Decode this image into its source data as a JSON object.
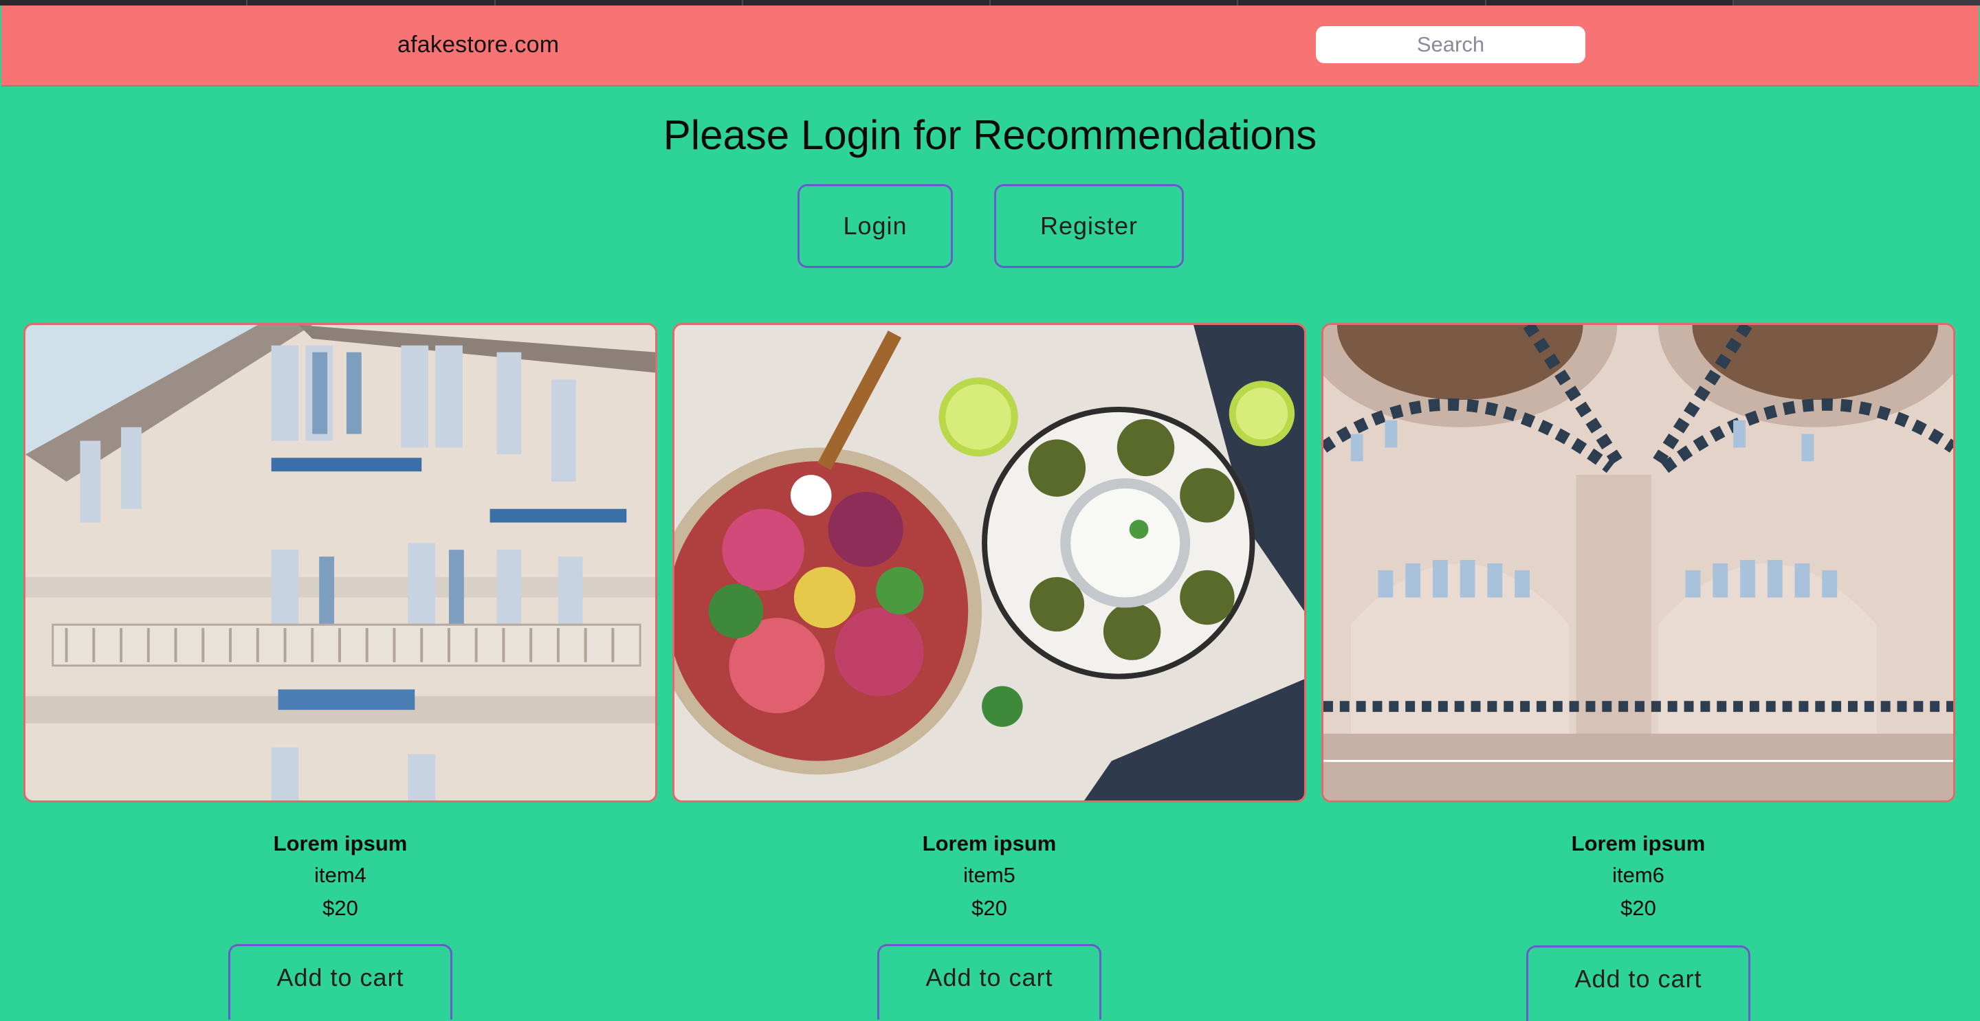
{
  "site": {
    "brand": "afakestore.com",
    "search_placeholder": "Search"
  },
  "hero": {
    "heading": "Please Login for Recommendations",
    "login_label": "Login",
    "register_label": "Register"
  },
  "products": [
    {
      "title": "Lorem ipsum",
      "item": "item4",
      "price": "$20",
      "cta": "Add to cart",
      "image": "building-facade-photo"
    },
    {
      "title": "Lorem ipsum",
      "item": "item5",
      "price": "$20",
      "cta": "Add to cart",
      "image": "salad-falafel-photo"
    },
    {
      "title": "Lorem ipsum",
      "item": "item6",
      "price": "$20",
      "cta": "Add to cart",
      "image": "mosque-interior-photo"
    }
  ],
  "colors": {
    "page_bg": "#2ed398",
    "navbar_bg": "#f87474",
    "button_border": "#6a5acd",
    "image_border": "#e46a6a"
  }
}
